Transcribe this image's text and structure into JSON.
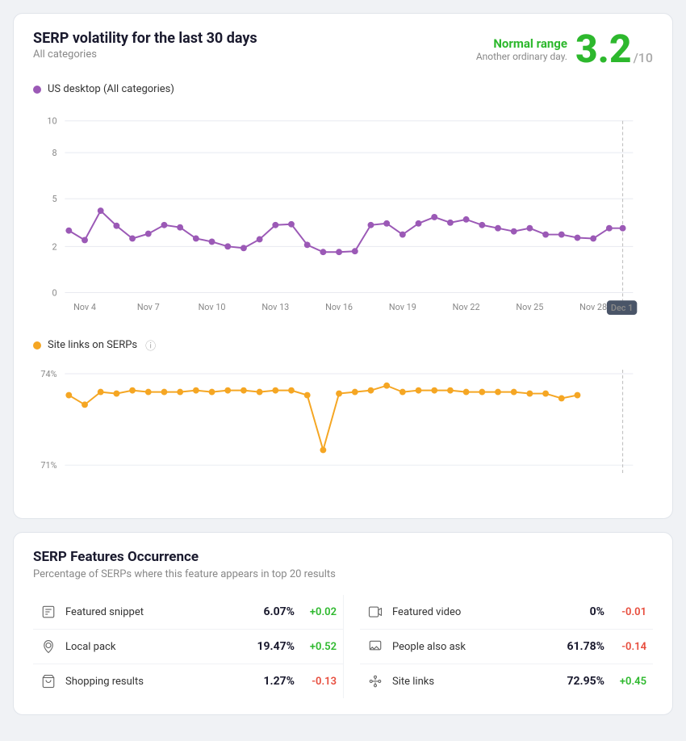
{
  "header": {
    "title": "SERP volatility for the last 30 days",
    "subtitle": "All categories",
    "range_label": "Normal range",
    "range_sub": "Another ordinary day.",
    "score": "3.2",
    "score_denom": "/10"
  },
  "chart1": {
    "legend_label": "US desktop (All categories)",
    "legend_color": "purple",
    "y_labels": [
      "10",
      "8",
      "5",
      "2",
      "0"
    ],
    "x_labels": [
      "Nov 4",
      "Nov 7",
      "Nov 10",
      "Nov 13",
      "Nov 16",
      "Nov 19",
      "Nov 22",
      "Nov 25",
      "Nov 28",
      "Dec 1"
    ],
    "data_points": [
      3.6,
      2.8,
      4.8,
      3.5,
      2.5,
      2.8,
      3.2,
      3.1,
      2.0,
      1.8,
      1.6,
      1.5,
      2.6,
      3.2,
      3.3,
      1.8,
      1.3,
      1.3,
      1.4,
      3.4,
      3.5,
      2.7,
      3.4,
      3.8,
      3.6,
      3.7,
      3.2,
      3.0,
      2.8,
      3.2,
      2.6,
      2.6,
      2.4,
      2.3,
      3.1
    ]
  },
  "chart2": {
    "legend_label": "Site links on SERPs",
    "legend_color": "orange",
    "y_top": "74%",
    "y_bottom": "71%",
    "data_points": [
      73.1,
      72.5,
      73.3,
      73.2,
      73.4,
      73.5,
      73.4,
      73.3,
      73.5,
      73.4,
      73.4,
      73.5,
      73.5,
      73.3,
      73.4,
      73.0,
      71.5,
      73.2,
      73.3,
      73.5,
      73.8,
      73.5,
      73.5,
      73.5,
      73.4,
      73.4,
      73.4,
      73.3,
      73.2,
      72.8,
      72.9,
      73.2
    ]
  },
  "features": {
    "title": "SERP Features Occurrence",
    "subtitle": "Percentage of SERPs where this feature appears in top 20 results",
    "left": [
      {
        "icon": "snippet",
        "name": "Featured snippet",
        "pct": "6.07%",
        "change": "+0.02",
        "positive": true
      },
      {
        "icon": "local",
        "name": "Local pack",
        "pct": "19.47%",
        "change": "+0.52",
        "positive": true
      },
      {
        "icon": "shopping",
        "name": "Shopping results",
        "pct": "1.27%",
        "change": "-0.13",
        "positive": false
      }
    ],
    "right": [
      {
        "icon": "video",
        "name": "Featured video",
        "pct": "0%",
        "change": "-0.01",
        "positive": false
      },
      {
        "icon": "people",
        "name": "People also ask",
        "pct": "61.78%",
        "change": "-0.14",
        "positive": false
      },
      {
        "icon": "sitelinks",
        "name": "Site links",
        "pct": "72.95%",
        "change": "+0.45",
        "positive": true
      }
    ]
  }
}
